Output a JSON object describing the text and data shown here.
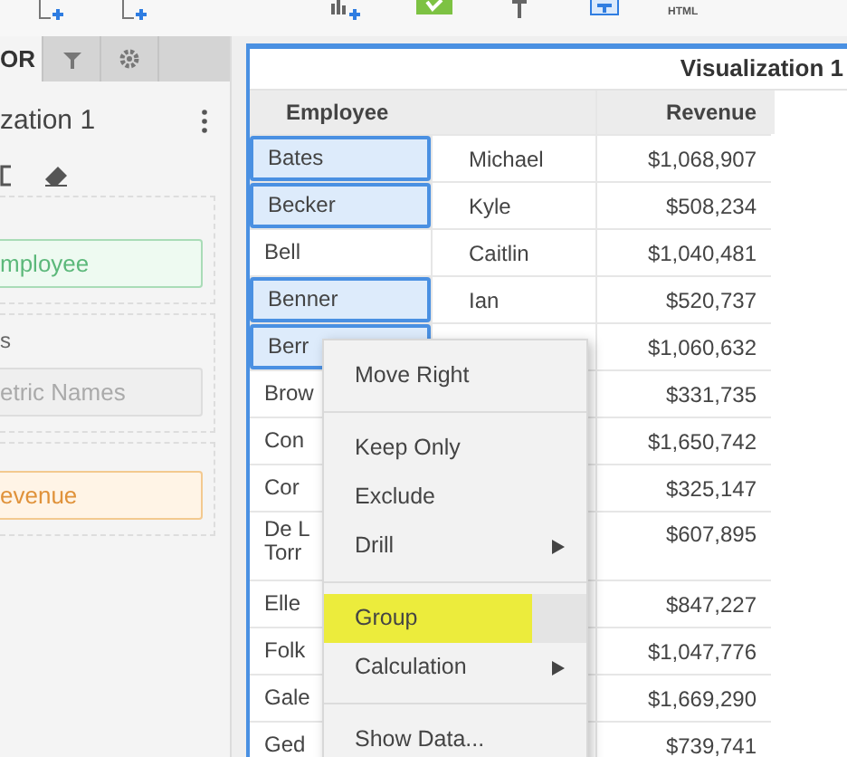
{
  "toolbar": {
    "html_label": "HTML"
  },
  "editor": {
    "tabs": [
      {
        "label": "OR",
        "kind": "text",
        "selected": true
      },
      {
        "kind": "filter",
        "selected": false
      },
      {
        "kind": "gear",
        "selected": false
      }
    ],
    "title": "zation 1",
    "rows_field": {
      "pill": "mployee"
    },
    "columns_field": {
      "label": "s",
      "placeholder": "etric Names"
    },
    "metrics_field": {
      "pill": "evenue"
    }
  },
  "visualization": {
    "title": "Visualization 1",
    "columns": [
      "Employee",
      "Revenue"
    ],
    "rows": [
      {
        "last": "Bates",
        "first": "Michael",
        "revenue": "$1,068,907",
        "selected": true
      },
      {
        "last": "Becker",
        "first": "Kyle",
        "revenue": "$508,234",
        "selected": true
      },
      {
        "last": "Bell",
        "first": "Caitlin",
        "revenue": "$1,040,481",
        "selected": false
      },
      {
        "last": "Benner",
        "first": "Ian",
        "revenue": "$520,737",
        "selected": true
      },
      {
        "last": "Berr",
        "revenue": "$1,060,632",
        "selected": true
      },
      {
        "last": "Brow",
        "revenue": "$331,735",
        "selected": false
      },
      {
        "last": "Con",
        "revenue": "$1,650,742",
        "selected": false
      },
      {
        "last": "Cor",
        "revenue": "$325,147",
        "selected": false
      },
      {
        "last": "De L\nTorr",
        "revenue": "$607,895",
        "selected": false
      },
      {
        "last": "Elle",
        "revenue": "$847,227",
        "selected": false
      },
      {
        "last": "Folk",
        "revenue": "$1,047,776",
        "selected": false
      },
      {
        "last": "Gale",
        "revenue": "$1,669,290",
        "selected": false
      },
      {
        "last": "Ged",
        "revenue": "$739,741",
        "selected": false
      }
    ]
  },
  "context_menu": {
    "groups": [
      [
        {
          "label": "Move Right",
          "submenu": false,
          "highlighted": false
        }
      ],
      [
        {
          "label": "Keep Only",
          "submenu": false,
          "highlighted": false
        },
        {
          "label": "Exclude",
          "submenu": false,
          "highlighted": false
        },
        {
          "label": "Drill",
          "submenu": true,
          "highlighted": false
        }
      ],
      [
        {
          "label": "Group",
          "submenu": false,
          "highlighted": true
        },
        {
          "label": "Calculation",
          "submenu": true,
          "highlighted": false
        }
      ],
      [
        {
          "label": "Show Data...",
          "submenu": false,
          "highlighted": false
        }
      ]
    ]
  }
}
